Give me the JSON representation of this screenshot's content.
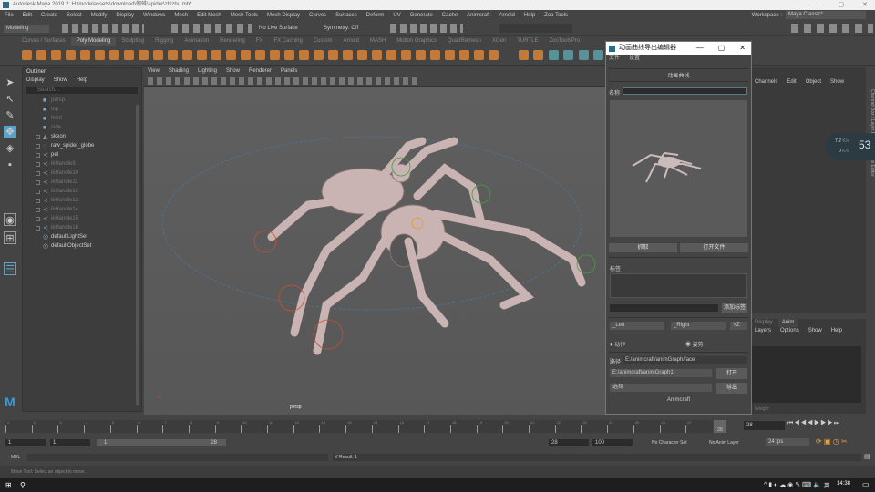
{
  "window": {
    "title": "Autodesk Maya 2019.2: H:\\modelassets\\download\\蜘蛛\\spider\\zhizhu.mb*",
    "minimize": "—",
    "maximize": "▢",
    "close": "✕"
  },
  "menubar": [
    "File",
    "Edit",
    "Create",
    "Select",
    "Modify",
    "Display",
    "Windows",
    "Mesh",
    "Edit Mesh",
    "Mesh Tools",
    "Mesh Display",
    "Curves",
    "Surfaces",
    "Deform",
    "UV",
    "Generate",
    "Cache",
    "Animcraft",
    "Arnold",
    "Help",
    "Zoo Tools"
  ],
  "workspace": {
    "label": "Workspace :",
    "value": "Maya Classic*"
  },
  "statusline": {
    "mode": "Modeling",
    "live_surface": "No Live Surface",
    "symmetry": "Symmetry: Off"
  },
  "shelf_tabs": [
    "Curves / Surfaces",
    "Poly Modeling",
    "Sculpting",
    "Rigging",
    "Animation",
    "Rendering",
    "FX",
    "FX Caching",
    "Custom",
    "Arnold",
    "MASH",
    "Motion Graphics",
    "QuadRemesh",
    "XGen",
    "TURTLE",
    "ZooToolsPro"
  ],
  "shelf_active": 1,
  "outliner": {
    "title": "Outliner",
    "menu": [
      "Display",
      "Show",
      "Help"
    ],
    "search_placeholder": "Search...",
    "items": [
      {
        "name": "persp",
        "dim": true,
        "icon": "camera"
      },
      {
        "name": "top",
        "dim": true,
        "icon": "camera"
      },
      {
        "name": "front",
        "dim": true,
        "icon": "camera"
      },
      {
        "name": "side",
        "dim": true,
        "icon": "camera"
      },
      {
        "name": "skeon",
        "dim": false,
        "icon": "mesh"
      },
      {
        "name": "raw_spider_globe",
        "dim": false,
        "icon": "curve"
      },
      {
        "name": "pel",
        "dim": false,
        "icon": "joint"
      },
      {
        "name": "ikHandle9",
        "dim": true,
        "icon": "ik"
      },
      {
        "name": "ikHandle10",
        "dim": true,
        "icon": "ik"
      },
      {
        "name": "ikHandle11",
        "dim": true,
        "icon": "ik"
      },
      {
        "name": "ikHandle12",
        "dim": true,
        "icon": "ik"
      },
      {
        "name": "ikHandle13",
        "dim": true,
        "icon": "ik"
      },
      {
        "name": "ikHandle14",
        "dim": true,
        "icon": "ik"
      },
      {
        "name": "ikHandle15",
        "dim": true,
        "icon": "ik"
      },
      {
        "name": "ikHandle16",
        "dim": true,
        "icon": "ik"
      },
      {
        "name": "defaultLightSet",
        "dim": false,
        "icon": "set"
      },
      {
        "name": "defaultObjectSet",
        "dim": false,
        "icon": "set"
      }
    ]
  },
  "viewport": {
    "menu": [
      "View",
      "Shading",
      "Lighting",
      "Show",
      "Renderer",
      "Panels"
    ],
    "camera_label": "persp"
  },
  "dialog": {
    "title": "动画曲线导出编辑器",
    "menu": [
      "文件",
      "设置"
    ],
    "section": "动画曲线",
    "name_label": "名称",
    "name_value": "",
    "grab": "抓取",
    "open_file": "打开文件",
    "tag_label": "标签",
    "add_tag": "添加标签",
    "left": "_Left",
    "right": "_Right",
    "axis": "YZ",
    "radio_action": "动作",
    "radio_pose": "姿势",
    "path_label": "路径",
    "path_value": "E:/animcraft/animGraph/face",
    "lib_path": "E:/animcraft/animGraph1",
    "open": "打开",
    "select": "选择",
    "export": "导出",
    "footer": "Animcraft"
  },
  "channelbox": {
    "menu": [
      "Channels",
      "Edit",
      "Object",
      "Show"
    ],
    "side_tab": "Channel Box / Layer Editor",
    "side_tab2": "Attribute Editor"
  },
  "fps_widget": {
    "up": "7.2",
    "up_unit": "K/s",
    "down": "0",
    "down_unit": "K/s",
    "value": "53"
  },
  "layers": {
    "tabs": [
      "Display",
      "Anim"
    ],
    "active_tab": 1,
    "menu": [
      "Layers",
      "Options",
      "Show",
      "Help"
    ],
    "weight_label": "Weight"
  },
  "timeline": {
    "ticks": [
      "1",
      "2",
      "3",
      "4",
      "5",
      "6",
      "7",
      "8",
      "9",
      "10",
      "11",
      "12",
      "13",
      "14",
      "15",
      "16",
      "17",
      "18",
      "19",
      "20",
      "21",
      "22",
      "23",
      "24",
      "25",
      "26",
      "27"
    ],
    "current": "28",
    "current_field": "28"
  },
  "range": {
    "start": "1",
    "anim_start": "1",
    "slider_start": "1",
    "slider_end": "28",
    "end": "28",
    "anim_end": "100",
    "char_set": "No Character Set",
    "anim_layer": "No Anim Layer",
    "fps": "24 fps"
  },
  "cmdline": {
    "lang": "MEL",
    "result": "// Result: 1"
  },
  "helpline": "Move Tool: Select an object to move.",
  "taskbar": {
    "time": "14:38",
    "ime": "英"
  }
}
